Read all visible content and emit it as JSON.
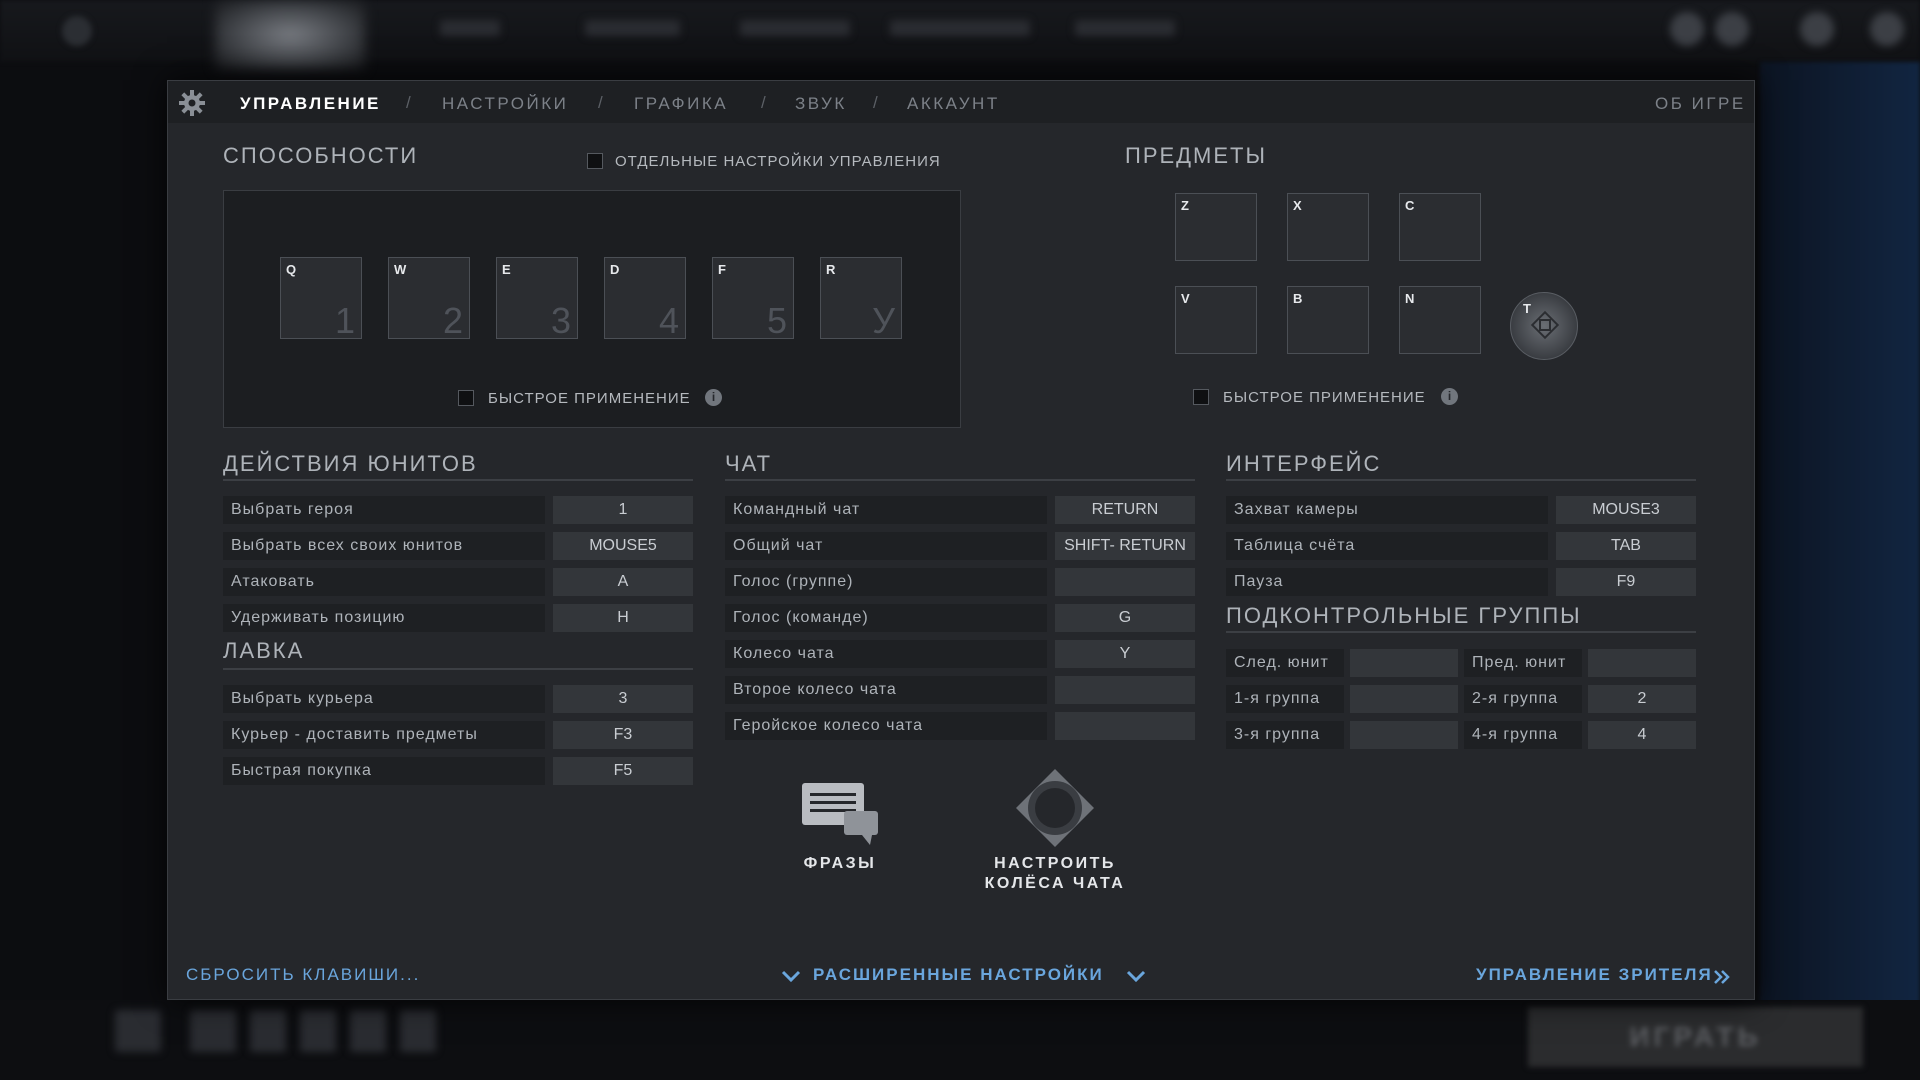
{
  "background": {
    "play_label": "ИГРАТЬ"
  },
  "tabs": {
    "controls": "УПРАВЛЕНИЕ",
    "settings": "НАСТРОЙКИ",
    "graphics": "ГРАФИКА",
    "sound": "ЗВУК",
    "account": "АККАУНТ",
    "separator": "/",
    "about": "ОБ ИГРЕ"
  },
  "abilities": {
    "title": "СПОСОБНОСТИ",
    "separate_controls_label": "ОТДЕЛЬНЫЕ НАСТРОЙКИ УПРАВЛЕНИЯ",
    "quick_cast_label": "БЫСТРОЕ ПРИМЕНЕНИЕ",
    "slots": [
      {
        "key": "Q",
        "num": "1"
      },
      {
        "key": "W",
        "num": "2"
      },
      {
        "key": "E",
        "num": "3"
      },
      {
        "key": "D",
        "num": "4"
      },
      {
        "key": "F",
        "num": "5"
      },
      {
        "key": "R",
        "num": "У"
      }
    ]
  },
  "items": {
    "title": "ПРЕДМЕТЫ",
    "quick_cast_label": "БЫСТРОЕ ПРИМЕНЕНИЕ",
    "slots": [
      "Z",
      "X",
      "C",
      "V",
      "B",
      "N"
    ],
    "tp_key": "T"
  },
  "unit_actions": {
    "title": "ДЕЙСТВИЯ ЮНИТОВ",
    "rows": [
      {
        "label": "Выбрать героя",
        "key": "1"
      },
      {
        "label": "Выбрать всех своих юнитов",
        "key": "MOUSE5"
      },
      {
        "label": "Атаковать",
        "key": "A"
      },
      {
        "label": "Удерживать позицию",
        "key": "H"
      }
    ]
  },
  "shop": {
    "title": "ЛАВКА",
    "rows": [
      {
        "label": "Выбрать курьера",
        "key": "3"
      },
      {
        "label": "Курьер - доставить предметы",
        "key": "F3"
      },
      {
        "label": "Быстрая покупка",
        "key": "F5"
      }
    ]
  },
  "chat": {
    "title": "ЧАТ",
    "rows": [
      {
        "label": "Командный чат",
        "key": "RETURN"
      },
      {
        "label": "Общий чат",
        "key": "SHIFT- RETURN"
      },
      {
        "label": "Голос (группе)",
        "key": ""
      },
      {
        "label": "Голос (команде)",
        "key": "G"
      },
      {
        "label": "Колесо чата",
        "key": "Y"
      },
      {
        "label": "Второе колесо чата",
        "key": ""
      },
      {
        "label": "Геройское колесо чата",
        "key": ""
      }
    ],
    "phrases_label": "ФРАЗЫ",
    "wheels_label_1": "НАСТРОИТЬ",
    "wheels_label_2": "КОЛЁСА ЧАТА"
  },
  "interface": {
    "title": "ИНТЕРФЕЙС",
    "rows": [
      {
        "label": "Захват камеры",
        "key": "MOUSE3"
      },
      {
        "label": "Таблица счёта",
        "key": "TAB"
      },
      {
        "label": "Пауза",
        "key": "F9"
      }
    ]
  },
  "control_groups": {
    "title": "ПОДКОНТРОЛЬНЫЕ ГРУППЫ",
    "rows": [
      {
        "l1": "След. юнит",
        "k1": "",
        "l2": "Пред. юнит",
        "k2": ""
      },
      {
        "l1": "1-я группа",
        "k1": "",
        "l2": "2-я группа",
        "k2": "2"
      },
      {
        "l1": "3-я группа",
        "k1": "",
        "l2": "4-я группа",
        "k2": "4"
      }
    ]
  },
  "footer": {
    "reset": "СБРОСИТЬ КЛАВИШИ...",
    "advanced": "РАСШИРЕННЫЕ НАСТРОЙКИ",
    "spectator": "УПРАВЛЕНИЕ ЗРИТЕЛЯ"
  }
}
